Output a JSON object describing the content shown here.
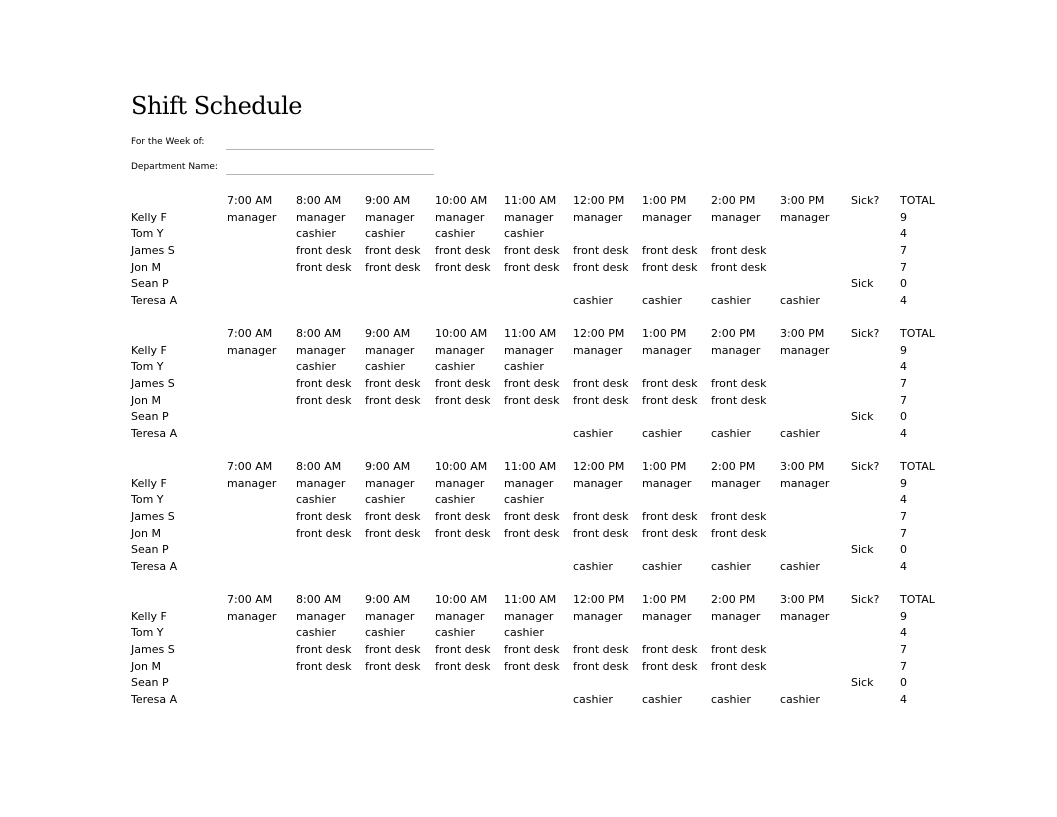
{
  "title": "Shift Schedule",
  "fields": [
    {
      "label": "For the Week of:",
      "value": ""
    },
    {
      "label": "Department Name:",
      "value": ""
    }
  ],
  "columns": [
    "7:00 AM",
    "8:00 AM",
    "9:00 AM",
    "10:00 AM",
    "11:00 AM",
    "12:00 PM",
    "1:00 PM",
    "2:00 PM",
    "3:00 PM",
    "Sick?",
    "TOTAL"
  ],
  "blocks": [
    {
      "rows": [
        {
          "name": "Kelly F",
          "cells": [
            "manager",
            "manager",
            "manager",
            "manager",
            "manager",
            "manager",
            "manager",
            "manager",
            "manager",
            "",
            "9"
          ]
        },
        {
          "name": "Tom Y",
          "cells": [
            "",
            "cashier",
            "cashier",
            "cashier",
            "cashier",
            "",
            "",
            "",
            "",
            "",
            "4"
          ]
        },
        {
          "name": "James S",
          "cells": [
            "",
            "front desk",
            "front desk",
            "front desk",
            "front desk",
            "front desk",
            "front desk",
            "front desk",
            "",
            "",
            "7"
          ]
        },
        {
          "name": "Jon M",
          "cells": [
            "",
            "front desk",
            "front desk",
            "front desk",
            "front desk",
            "front desk",
            "front desk",
            "front desk",
            "",
            "",
            "7"
          ]
        },
        {
          "name": "Sean P",
          "cells": [
            "",
            "",
            "",
            "",
            "",
            "",
            "",
            "",
            "",
            "Sick",
            "0"
          ]
        },
        {
          "name": "Teresa A",
          "cells": [
            "",
            "",
            "",
            "",
            "",
            "cashier",
            "cashier",
            "cashier",
            "cashier",
            "",
            "4"
          ]
        }
      ]
    },
    {
      "rows": [
        {
          "name": "Kelly F",
          "cells": [
            "manager",
            "manager",
            "manager",
            "manager",
            "manager",
            "manager",
            "manager",
            "manager",
            "manager",
            "",
            "9"
          ]
        },
        {
          "name": "Tom Y",
          "cells": [
            "",
            "cashier",
            "cashier",
            "cashier",
            "cashier",
            "",
            "",
            "",
            "",
            "",
            "4"
          ]
        },
        {
          "name": "James S",
          "cells": [
            "",
            "front desk",
            "front desk",
            "front desk",
            "front desk",
            "front desk",
            "front desk",
            "front desk",
            "",
            "",
            "7"
          ]
        },
        {
          "name": "Jon M",
          "cells": [
            "",
            "front desk",
            "front desk",
            "front desk",
            "front desk",
            "front desk",
            "front desk",
            "front desk",
            "",
            "",
            "7"
          ]
        },
        {
          "name": "Sean P",
          "cells": [
            "",
            "",
            "",
            "",
            "",
            "",
            "",
            "",
            "",
            "Sick",
            "0"
          ]
        },
        {
          "name": "Teresa A",
          "cells": [
            "",
            "",
            "",
            "",
            "",
            "cashier",
            "cashier",
            "cashier",
            "cashier",
            "",
            "4"
          ]
        }
      ]
    },
    {
      "rows": [
        {
          "name": "Kelly F",
          "cells": [
            "manager",
            "manager",
            "manager",
            "manager",
            "manager",
            "manager",
            "manager",
            "manager",
            "manager",
            "",
            "9"
          ]
        },
        {
          "name": "Tom Y",
          "cells": [
            "",
            "cashier",
            "cashier",
            "cashier",
            "cashier",
            "",
            "",
            "",
            "",
            "",
            "4"
          ]
        },
        {
          "name": "James S",
          "cells": [
            "",
            "front desk",
            "front desk",
            "front desk",
            "front desk",
            "front desk",
            "front desk",
            "front desk",
            "",
            "",
            "7"
          ]
        },
        {
          "name": "Jon M",
          "cells": [
            "",
            "front desk",
            "front desk",
            "front desk",
            "front desk",
            "front desk",
            "front desk",
            "front desk",
            "",
            "",
            "7"
          ]
        },
        {
          "name": "Sean P",
          "cells": [
            "",
            "",
            "",
            "",
            "",
            "",
            "",
            "",
            "",
            "Sick",
            "0"
          ]
        },
        {
          "name": "Teresa A",
          "cells": [
            "",
            "",
            "",
            "",
            "",
            "cashier",
            "cashier",
            "cashier",
            "cashier",
            "",
            "4"
          ]
        }
      ]
    },
    {
      "rows": [
        {
          "name": "Kelly F",
          "cells": [
            "manager",
            "manager",
            "manager",
            "manager",
            "manager",
            "manager",
            "manager",
            "manager",
            "manager",
            "",
            "9"
          ]
        },
        {
          "name": "Tom Y",
          "cells": [
            "",
            "cashier",
            "cashier",
            "cashier",
            "cashier",
            "",
            "",
            "",
            "",
            "",
            "4"
          ]
        },
        {
          "name": "James S",
          "cells": [
            "",
            "front desk",
            "front desk",
            "front desk",
            "front desk",
            "front desk",
            "front desk",
            "front desk",
            "",
            "",
            "7"
          ]
        },
        {
          "name": "Jon M",
          "cells": [
            "",
            "front desk",
            "front desk",
            "front desk",
            "front desk",
            "front desk",
            "front desk",
            "front desk",
            "",
            "",
            "7"
          ]
        },
        {
          "name": "Sean P",
          "cells": [
            "",
            "",
            "",
            "",
            "",
            "",
            "",
            "",
            "",
            "Sick",
            "0"
          ]
        },
        {
          "name": "Teresa A",
          "cells": [
            "",
            "",
            "",
            "",
            "",
            "cashier",
            "cashier",
            "cashier",
            "cashier",
            "",
            "4"
          ]
        }
      ]
    }
  ]
}
